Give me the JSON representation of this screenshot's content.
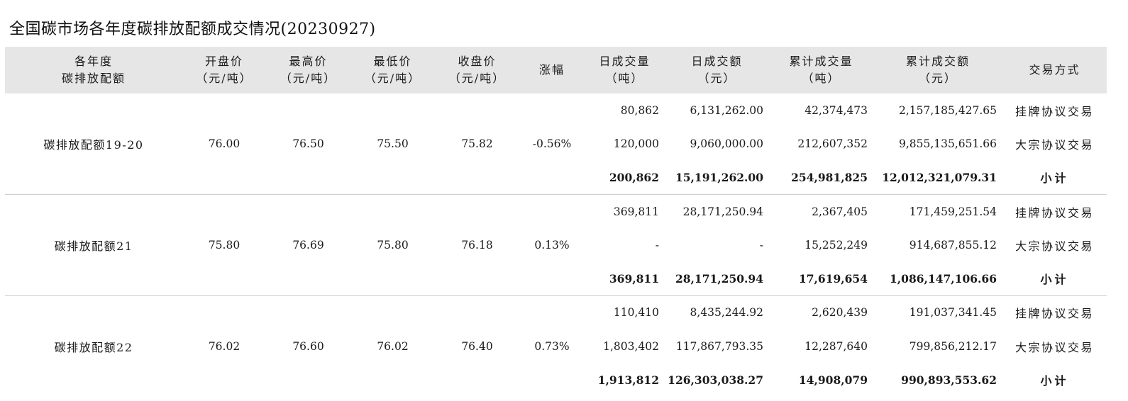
{
  "title": "全国碳市场各年度碳排放配额成交情况(20230927)",
  "headers": [
    [
      "各年度",
      "碳排放配额"
    ],
    [
      "开盘价",
      "（元/吨）"
    ],
    [
      "最高价",
      "（元/吨）"
    ],
    [
      "最低价",
      "（元/吨）"
    ],
    [
      "收盘价",
      "（元/吨）"
    ],
    [
      "涨幅"
    ],
    [
      "日成交量",
      "（吨）"
    ],
    [
      "日成交额",
      "（元）"
    ],
    [
      "累计成交量",
      "（吨）"
    ],
    [
      "累计成交额",
      "（元）"
    ],
    [
      "交易方式"
    ]
  ],
  "groups": [
    {
      "name": "碳排放配额19-20",
      "open": "76.00",
      "high": "76.50",
      "low": "75.50",
      "close": "75.82",
      "change": "-0.56%",
      "rows": [
        {
          "daily_volume": "80,862",
          "daily_amount": "6,131,262.00",
          "cum_volume": "42,374,473",
          "cum_amount": "2,157,185,427.65",
          "mode": "挂牌协议交易"
        },
        {
          "daily_volume": "120,000",
          "daily_amount": "9,060,000.00",
          "cum_volume": "212,607,352",
          "cum_amount": "9,855,135,651.66",
          "mode": "大宗协议交易"
        },
        {
          "daily_volume": "200,862",
          "daily_amount": "15,191,262.00",
          "cum_volume": "254,981,825",
          "cum_amount": "12,012,321,079.31",
          "mode": "小计"
        }
      ]
    },
    {
      "name": "碳排放配额21",
      "open": "75.80",
      "high": "76.69",
      "low": "75.80",
      "close": "76.18",
      "change": "0.13%",
      "rows": [
        {
          "daily_volume": "369,811",
          "daily_amount": "28,171,250.94",
          "cum_volume": "2,367,405",
          "cum_amount": "171,459,251.54",
          "mode": "挂牌协议交易"
        },
        {
          "daily_volume": "-",
          "daily_amount": "-",
          "cum_volume": "15,252,249",
          "cum_amount": "914,687,855.12",
          "mode": "大宗协议交易"
        },
        {
          "daily_volume": "369,811",
          "daily_amount": "28,171,250.94",
          "cum_volume": "17,619,654",
          "cum_amount": "1,086,147,106.66",
          "mode": "小计"
        }
      ]
    },
    {
      "name": "碳排放配额22",
      "open": "76.02",
      "high": "76.60",
      "low": "76.02",
      "close": "76.40",
      "change": "0.73%",
      "rows": [
        {
          "daily_volume": "110,410",
          "daily_amount": "8,435,244.92",
          "cum_volume": "2,620,439",
          "cum_amount": "191,037,341.45",
          "mode": "挂牌协议交易"
        },
        {
          "daily_volume": "1,803,402",
          "daily_amount": "117,867,793.35",
          "cum_volume": "12,287,640",
          "cum_amount": "799,856,212.17",
          "mode": "大宗协议交易"
        },
        {
          "daily_volume": "1,913,812",
          "daily_amount": "126,303,038.27",
          "cum_volume": "14,908,079",
          "cum_amount": "990,893,553.62",
          "mode": "小计"
        }
      ]
    }
  ]
}
